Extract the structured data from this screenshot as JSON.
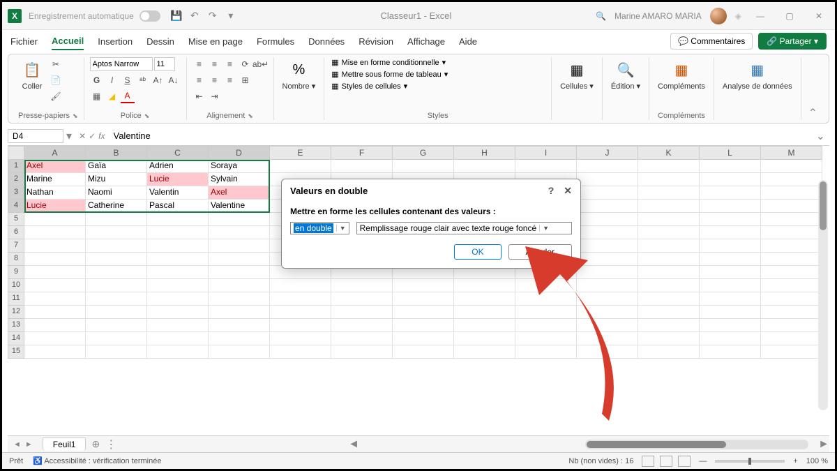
{
  "titlebar": {
    "autosave": "Enregistrement automatique",
    "doc_title": "Classeur1 - Excel",
    "user": "Marine AMARO MARIA"
  },
  "tabs": {
    "items": [
      "Fichier",
      "Accueil",
      "Insertion",
      "Dessin",
      "Mise en page",
      "Formules",
      "Données",
      "Révision",
      "Affichage",
      "Aide"
    ],
    "active": 1,
    "comments": "Commentaires",
    "share": "Partager"
  },
  "ribbon": {
    "clipboard": {
      "label": "Presse-papiers",
      "paste": "Coller"
    },
    "font": {
      "label": "Police",
      "name": "Aptos Narrow",
      "size": "11"
    },
    "alignment": {
      "label": "Alignement"
    },
    "number": {
      "label": "Nombre",
      "btn": "Nombre"
    },
    "styles": {
      "label": "Styles",
      "cond": "Mise en forme conditionnelle",
      "table": "Mettre sous forme de tableau",
      "cell": "Styles de cellules"
    },
    "cells": {
      "label": "Cellules",
      "btn": "Cellules"
    },
    "editing": {
      "label": "Édition",
      "btn": "Édition"
    },
    "addins": {
      "label": "Compléments",
      "btn": "Compléments"
    },
    "analyze": {
      "label": "",
      "btn": "Analyse de données"
    }
  },
  "formula": {
    "cell_ref": "D4",
    "value": "Valentine"
  },
  "columns": [
    "A",
    "B",
    "C",
    "D",
    "E",
    "F",
    "G",
    "H",
    "I",
    "J",
    "K",
    "L",
    "M"
  ],
  "grid": {
    "rows": [
      [
        {
          "v": "Axel",
          "d": true
        },
        {
          "v": "Gaïa"
        },
        {
          "v": "Adrien"
        },
        {
          "v": "Soraya"
        }
      ],
      [
        {
          "v": "Marine"
        },
        {
          "v": "Mizu"
        },
        {
          "v": "Lucie",
          "d": true
        },
        {
          "v": "Sylvain"
        }
      ],
      [
        {
          "v": "Nathan"
        },
        {
          "v": "Naomi"
        },
        {
          "v": "Valentin"
        },
        {
          "v": "Axel",
          "d": true
        }
      ],
      [
        {
          "v": "Lucie",
          "d": true
        },
        {
          "v": "Catherine"
        },
        {
          "v": "Pascal"
        },
        {
          "v": "Valentine"
        }
      ]
    ]
  },
  "dialog": {
    "title": "Valeurs en double",
    "prompt": "Mettre en forme les cellules contenant des valeurs :",
    "combo1": "en double",
    "combo2": "Remplissage rouge clair avec texte rouge foncé",
    "ok": "OK",
    "cancel": "Annuler"
  },
  "sheet": {
    "name": "Feuil1"
  },
  "status": {
    "ready": "Prêt",
    "access": "Accessibilité : vérification terminée",
    "count": "Nb (non vides) : 16",
    "zoom": "100 %"
  }
}
